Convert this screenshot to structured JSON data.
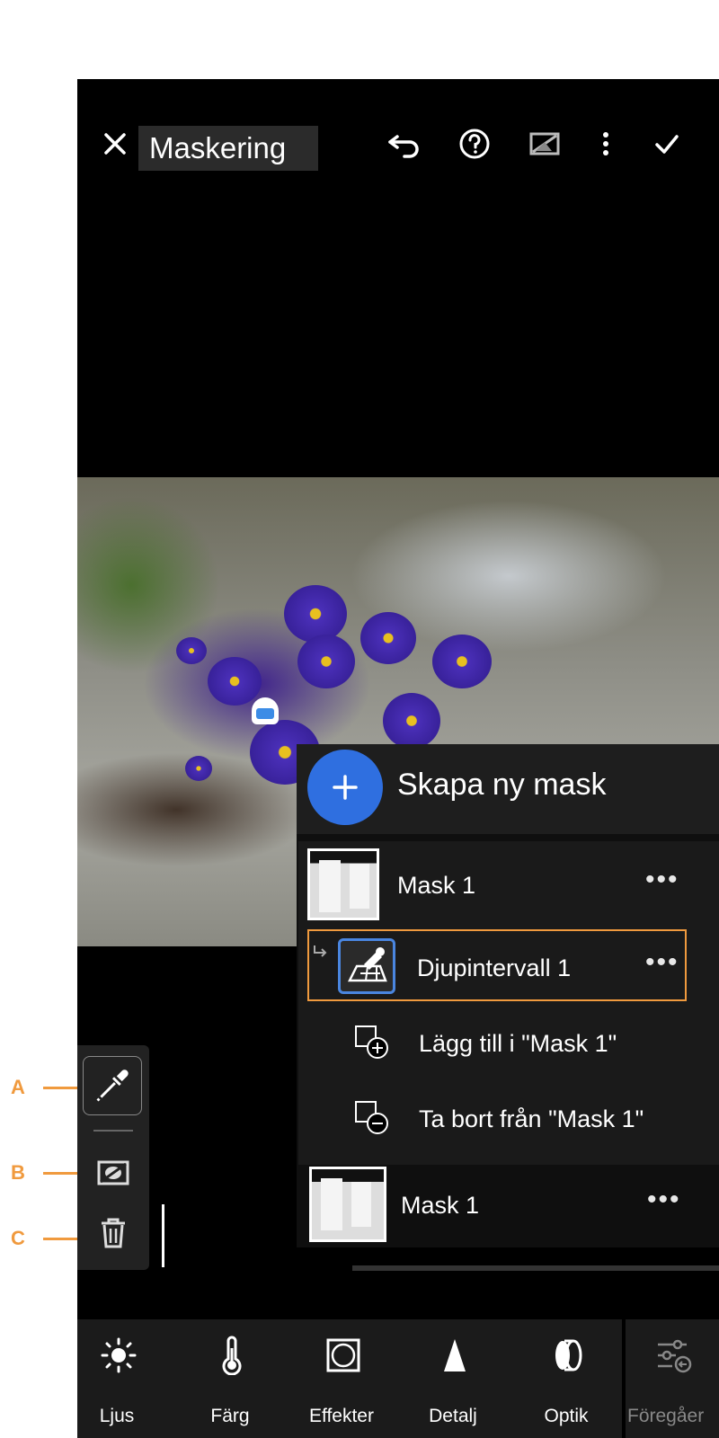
{
  "app": {
    "title": "Maskering"
  },
  "callouts": [
    "A",
    "B",
    "C"
  ],
  "mask_panel": {
    "create_label": "Skapa ny mask",
    "masks": [
      {
        "label": "Mask 1"
      },
      {
        "label": "Mask 1"
      }
    ],
    "selected_subcomponent": {
      "label": "Djupintervall 1"
    },
    "actions": {
      "add": "Lägg till i \"Mask 1\"",
      "remove": "Ta bort från \"Mask 1\""
    }
  },
  "bottom_nav": {
    "items": [
      {
        "label": "Ljus",
        "icon": "sun-icon"
      },
      {
        "label": "Färg",
        "icon": "thermometer-icon"
      },
      {
        "label": "Effekter",
        "icon": "vignette-icon"
      },
      {
        "label": "Detalj",
        "icon": "triangle-icon"
      },
      {
        "label": "Optik",
        "icon": "lens-icon"
      },
      {
        "label": "Föregåer",
        "icon": "presets-icon"
      }
    ]
  },
  "colors": {
    "accent_blue": "#2f6fe0",
    "callout_orange": "#f09a3e",
    "background": "#000000"
  }
}
